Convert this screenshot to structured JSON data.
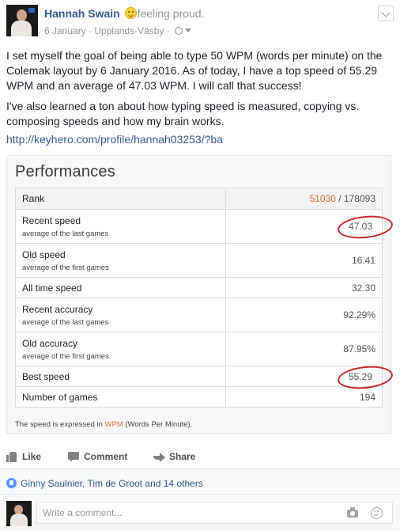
{
  "post": {
    "author": "Hannah Swain",
    "feeling": "feeling proud.",
    "date": "6 January",
    "location": "Upplands-Väsby",
    "separator": "·",
    "paragraph_1": "I set myself the goal of being able to type 50 WPM (words per minute) on the Colemak layout by 6 January 2016. As of today, I have a top speed of 55.29 WPM and an average of 47.03 WPM. I will call that success!",
    "paragraph_2": "I've also learned a ton about how typing speed is measured, copying vs. composing speeds and how my brain works.",
    "link": "http://keyhero.com/profile/hannah03253/?ba"
  },
  "card": {
    "title": "Performances",
    "rank": {
      "label": "Rank",
      "value": "51030",
      "total": "/ 178093"
    },
    "rows": [
      {
        "label": "Recent speed",
        "sub": "average of the last games",
        "value": "47.03"
      },
      {
        "label": "Old speed",
        "sub": "average of the first games",
        "value": "16.41"
      },
      {
        "label": "All time speed",
        "sub": "",
        "value": "32.30"
      },
      {
        "label": "Recent accuracy",
        "sub": "average of the last games",
        "value": "92.29%"
      },
      {
        "label": "Old accuracy",
        "sub": "average of the first games",
        "value": "87.95%"
      },
      {
        "label": "Best speed",
        "sub": "",
        "value": "55.29"
      },
      {
        "label": "Number of games",
        "sub": "",
        "value": "194"
      }
    ],
    "footnote_pre": "The speed is expressed in",
    "footnote_wpm": "WPM",
    "footnote_post": "(Words Per Minute)."
  },
  "actions": {
    "like": "Like",
    "comment": "Comment",
    "share": "Share"
  },
  "likes": {
    "text": "Ginny Saulnier, Tim de Groot and 14 others"
  },
  "comment_box": {
    "placeholder": "Write a comment..."
  },
  "colors": {
    "link": "#365899",
    "accent_orange": "#d9743b",
    "highlight_circle": "#c8262b",
    "like_blue": "#5890ff"
  }
}
